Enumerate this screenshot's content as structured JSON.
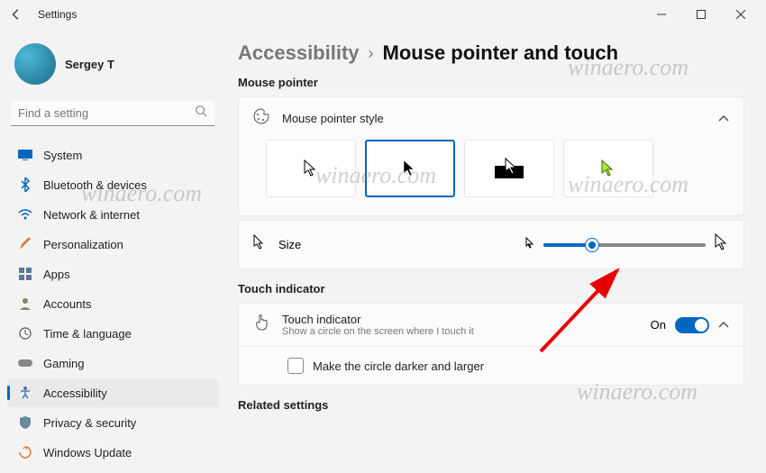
{
  "app_title": "Settings",
  "user": {
    "name": "Sergey T"
  },
  "search": {
    "placeholder": "Find a setting"
  },
  "nav": [
    {
      "label": "System",
      "icon": "system"
    },
    {
      "label": "Bluetooth & devices",
      "icon": "bluetooth"
    },
    {
      "label": "Network & internet",
      "icon": "wifi"
    },
    {
      "label": "Personalization",
      "icon": "brush"
    },
    {
      "label": "Apps",
      "icon": "apps"
    },
    {
      "label": "Accounts",
      "icon": "accounts"
    },
    {
      "label": "Time & language",
      "icon": "time"
    },
    {
      "label": "Gaming",
      "icon": "gaming"
    },
    {
      "label": "Accessibility",
      "icon": "accessibility",
      "active": true
    },
    {
      "label": "Privacy & security",
      "icon": "privacy"
    },
    {
      "label": "Windows Update",
      "icon": "update"
    }
  ],
  "breadcrumb": {
    "parent": "Accessibility",
    "current": "Mouse pointer and touch"
  },
  "sections": {
    "mouse_pointer": {
      "label": "Mouse pointer",
      "style_header": "Mouse pointer style",
      "size_label": "Size",
      "styles": [
        "white",
        "black",
        "inverted",
        "custom"
      ],
      "selected_style_index": 1,
      "size_slider": {
        "value_percent": 30
      }
    },
    "touch": {
      "label": "Touch indicator",
      "title": "Touch indicator",
      "subtitle": "Show a circle on the screen where I touch it",
      "toggle_state": "On",
      "checkbox_label": "Make the circle darker and larger",
      "checkbox_checked": false
    },
    "related": {
      "label": "Related settings"
    }
  },
  "watermark": "winaero.com"
}
